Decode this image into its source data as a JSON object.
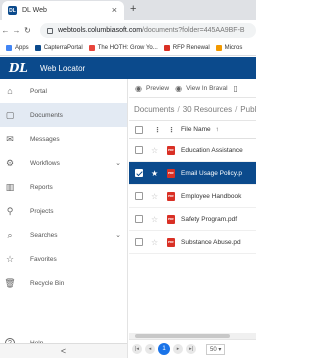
{
  "browser": {
    "tab_title": "DL Web",
    "tab_favicon": "DL",
    "new_tab": "+",
    "url_host": "webtools.columbiasoft.com",
    "url_path": "/documents?folder=445AA9BF-B",
    "bookmarks": [
      {
        "label": "Apps",
        "color": "#4285f4"
      },
      {
        "label": "CapterraPortal",
        "color": "#0b4a8c"
      },
      {
        "label": "The HOTH: Grow Yo...",
        "color": "#e8453c"
      },
      {
        "label": "RFP Renewal",
        "color": "#d93025"
      },
      {
        "label": "Micros",
        "color": "#f29900"
      }
    ]
  },
  "app": {
    "logo": "DL",
    "title": "Web Locator",
    "brand_color": "#0b4a8c"
  },
  "sidebar": {
    "items": [
      {
        "label": "Portal",
        "icon": "home-icon"
      },
      {
        "label": "Documents",
        "icon": "document-icon"
      },
      {
        "label": "Messages",
        "icon": "mail-icon"
      },
      {
        "label": "Workflows",
        "icon": "workflow-icon",
        "expandable": true
      },
      {
        "label": "Reports",
        "icon": "chart-icon"
      },
      {
        "label": "Projects",
        "icon": "project-icon"
      },
      {
        "label": "Searches",
        "icon": "search-icon",
        "expandable": true
      },
      {
        "label": "Favorites",
        "icon": "star-icon"
      },
      {
        "label": "Recycle Bin",
        "icon": "trash-icon"
      },
      {
        "label": "Help",
        "icon": "help-icon"
      }
    ],
    "active": "Documents",
    "collapse": "<"
  },
  "toolbar": {
    "preview": "Preview",
    "view_in_brava": "View In Braval"
  },
  "breadcrumb": {
    "root": "Documents",
    "current": "30 Resources",
    "next": "Publis"
  },
  "table": {
    "header": {
      "name": "File Name",
      "sort": "↑"
    },
    "rows": [
      {
        "name": "Education Assistance",
        "selected": false
      },
      {
        "name": "Email Usage Policy.p",
        "selected": true
      },
      {
        "name": "Employee Handbook",
        "selected": false
      },
      {
        "name": "Safety Program.pdf",
        "selected": false
      },
      {
        "name": "Substance Abuse.pd",
        "selected": false
      }
    ],
    "file_badge": "PDF"
  },
  "pager": {
    "current_page": "1",
    "per_page": "50"
  }
}
